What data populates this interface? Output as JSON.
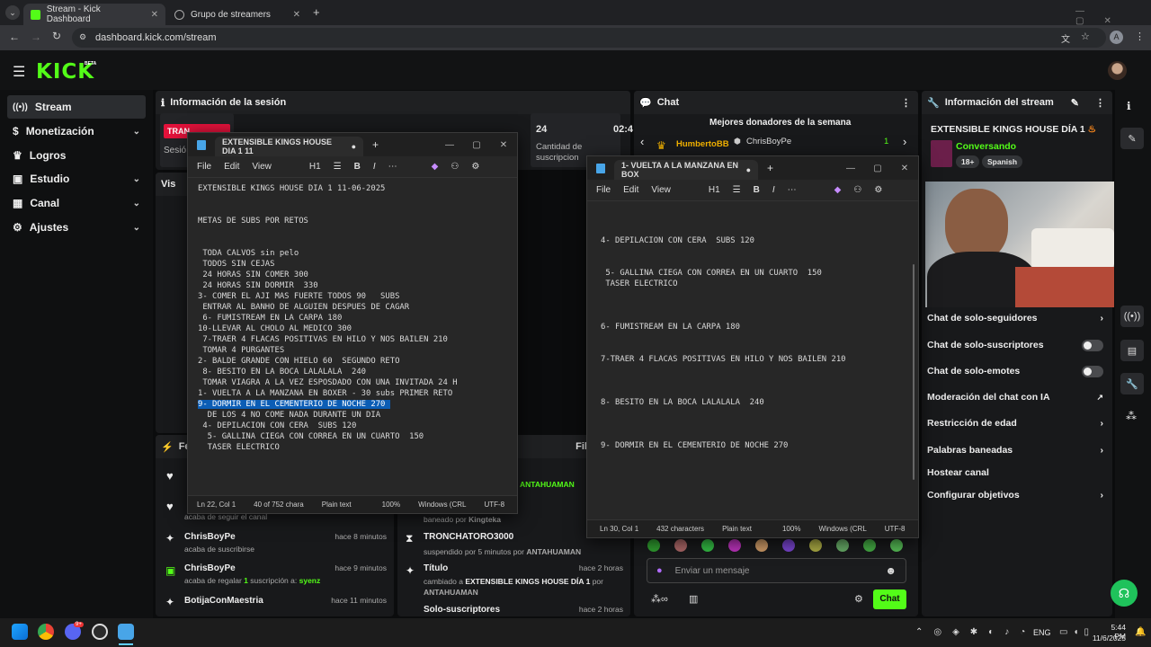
{
  "browser": {
    "tabs": [
      {
        "label": "Stream - Kick Dashboard",
        "active": true
      },
      {
        "label": "Grupo de streamers",
        "active": false
      }
    ],
    "url": "dashboard.kick.com/stream",
    "profile_initial": "A"
  },
  "kick": {
    "logo": "KICK",
    "logo_badge": "BETA"
  },
  "sidebar": {
    "items": [
      {
        "label": "Stream",
        "icon": "broadcast-icon"
      },
      {
        "label": "Monetización",
        "icon": "dollar-icon"
      },
      {
        "label": "Logros",
        "icon": "trophy-icon"
      },
      {
        "label": "Estudio",
        "icon": "studio-icon"
      },
      {
        "label": "Canal",
        "icon": "grid-icon"
      },
      {
        "label": "Ajustes",
        "icon": "gear-icon"
      }
    ]
  },
  "session": {
    "title": "Información de la sesión",
    "tiles": [
      {
        "label": "Sesió",
        "value": "TRAN"
      },
      {
        "label": "Cantidad de suscripcion",
        "value": "24"
      },
      {
        "label": "",
        "value": "02:4"
      }
    ]
  },
  "left_panel_partial": {
    "title": "Vis"
  },
  "feed": {
    "title": "Fee",
    "items": [
      {
        "name": "",
        "sub": "acaba de seguir el canal",
        "time": ""
      },
      {
        "name": "ChrisBoyPe",
        "sub": "acaba de suscribirse",
        "time": "hace 8 minutos"
      },
      {
        "name": "ChrisBoyPe",
        "sub_prefix": "acaba de regalar ",
        "sub_count": "1",
        "sub_mid": " suscripción a: ",
        "sub_user": "syenz",
        "time": "hace 9 minutos"
      },
      {
        "name": "BotijaConMaestria",
        "sub": "",
        "time": "hace 11 minutos"
      }
    ]
  },
  "mod_feed": {
    "title_partial": "Fil",
    "items": [
      {
        "name": "",
        "sub": "",
        "user": "ANTAHUAMAN",
        "time": ""
      },
      {
        "name": "",
        "sub": "baneado por ",
        "user": "Kingteka",
        "time": ""
      },
      {
        "name": "TRONCHATORO3000",
        "sub": "suspendido por 5 minutos por ",
        "user": "ANTAHUAMAN",
        "time": "hace 2 horas"
      },
      {
        "name": "Título",
        "sub": "cambiado a ",
        "bold": "EXTENSIBLE KINGS HOUSE DÍA 1",
        "sub2": " por",
        "user": "ANTAHUAMAN",
        "time": "hace 2 horas"
      },
      {
        "name": "Solo-suscriptores",
        "sub": "",
        "time": "hace 2 horas"
      }
    ]
  },
  "chat": {
    "title": "Chat",
    "donors_title": "Mejores donadores de la semana",
    "donor1": "HumbertoBB",
    "donor2": "ChrisBoyPe",
    "donor2_count": "1",
    "input_placeholder": "Enviar un mensaje",
    "send_label": "Chat"
  },
  "stream_info": {
    "title": "Información del stream",
    "stream_title": "EXTENSIBLE KINGS HOUSE DÍA 1",
    "category": "Conversando",
    "tags": [
      "18+",
      "Spanish"
    ],
    "settings": [
      {
        "label": "Chat de solo-seguidores",
        "control": "chevron"
      },
      {
        "label": "Chat de solo-suscriptores",
        "control": "toggle"
      },
      {
        "label": "Chat de solo-emotes",
        "control": "toggle"
      },
      {
        "label": "Moderación del chat con IA",
        "control": "external"
      },
      {
        "label": "Restricción de edad",
        "control": "chevron"
      },
      {
        "label": "Palabras baneadas",
        "control": "chevron"
      },
      {
        "label": "Hostear canal",
        "control": "none"
      },
      {
        "label": "Configurar objetivos",
        "control": "chevron"
      }
    ]
  },
  "notepad1": {
    "tab_title": "EXTENSIBLE KINGS HOUSE DIA 1 11",
    "menu": [
      "File",
      "Edit",
      "View"
    ],
    "heading": "H1",
    "lines_before": "EXTENSIBLE KINGS HOUSE DIA 1 11-06-2025\n\n\nMETAS DE SUBS POR RETOS\n\n\n TODA CALVOS sin pelo\n TODOS SIN CEJAS\n 24 HORAS SIN COMER 300\n 24 HORAS SIN DORMIR  330\n3- COMER EL AJI MAS FUERTE TODOS 90   SUBS\n ENTRAR AL BANHO DE ALGUIEN DESPUES DE CAGAR\n 6- FUMISTREAM EN LA CARPA 180\n10-LLEVAR AL CHOLO AL MEDICO 300\n 7-TRAER 4 FLACAS POSITIVAS EN HILO Y NOS BAILEN 210\n TOMAR 4 PURGANTES\n2- BALDE GRANDE CON HIELO 60  SEGUNDO RETO\n 8- BESITO EN LA BOCA LALALALA  240\n TOMAR VIAGRA A LA VEZ ESPOSDADO CON UNA INVITADA 24 H\n1- VUELTA A LA MANZANA EN BOXER - 30 subs PRIMER RETO",
    "highlighted_line": "9- DORMIR EN EL CEMENTERIO DE NOCHE 270 ",
    "lines_after": "  DE LOS 4 NO COME NADA DURANTE UN DIA\n 4- DEPILACION CON CERA  SUBS 120\n  5- GALLINA CIEGA CON CORREA EN UN CUARTO  150\n  TASER ELECTRICO",
    "status": [
      "Ln 22, Col 1",
      "40 of 752 chara",
      "Plain text",
      "100%",
      "Windows (CRL",
      "UTF-8"
    ]
  },
  "notepad2": {
    "tab_title": "1- VUELTA A LA MANZANA EN BOX",
    "menu": [
      "File",
      "Edit",
      "View"
    ],
    "heading": "H1",
    "text": "\n4- DEPILACION CON CERA  SUBS 120\n\n\n 5- GALLINA CIEGA CON CORREA EN UN CUARTO  150\n TASER ELECTRICO\n\n\n\n6- FUMISTREAM EN LA CARPA 180\n\n\n7-TRAER 4 FLACAS POSITIVAS EN HILO Y NOS BAILEN 210\n\n\n\n8- BESITO EN LA BOCA LALALALA  240\n\n\n\n9- DORMIR EN EL CEMENTERIO DE NOCHE 270",
    "status": [
      "Ln 30, Col 1",
      "432 characters",
      "Plain text",
      "100%",
      "Windows (CRL",
      "UTF-8"
    ]
  },
  "taskbar": {
    "language": "ENG",
    "time": "5:44 PM",
    "date": "11/6/2025",
    "discord_badge": "9+"
  }
}
